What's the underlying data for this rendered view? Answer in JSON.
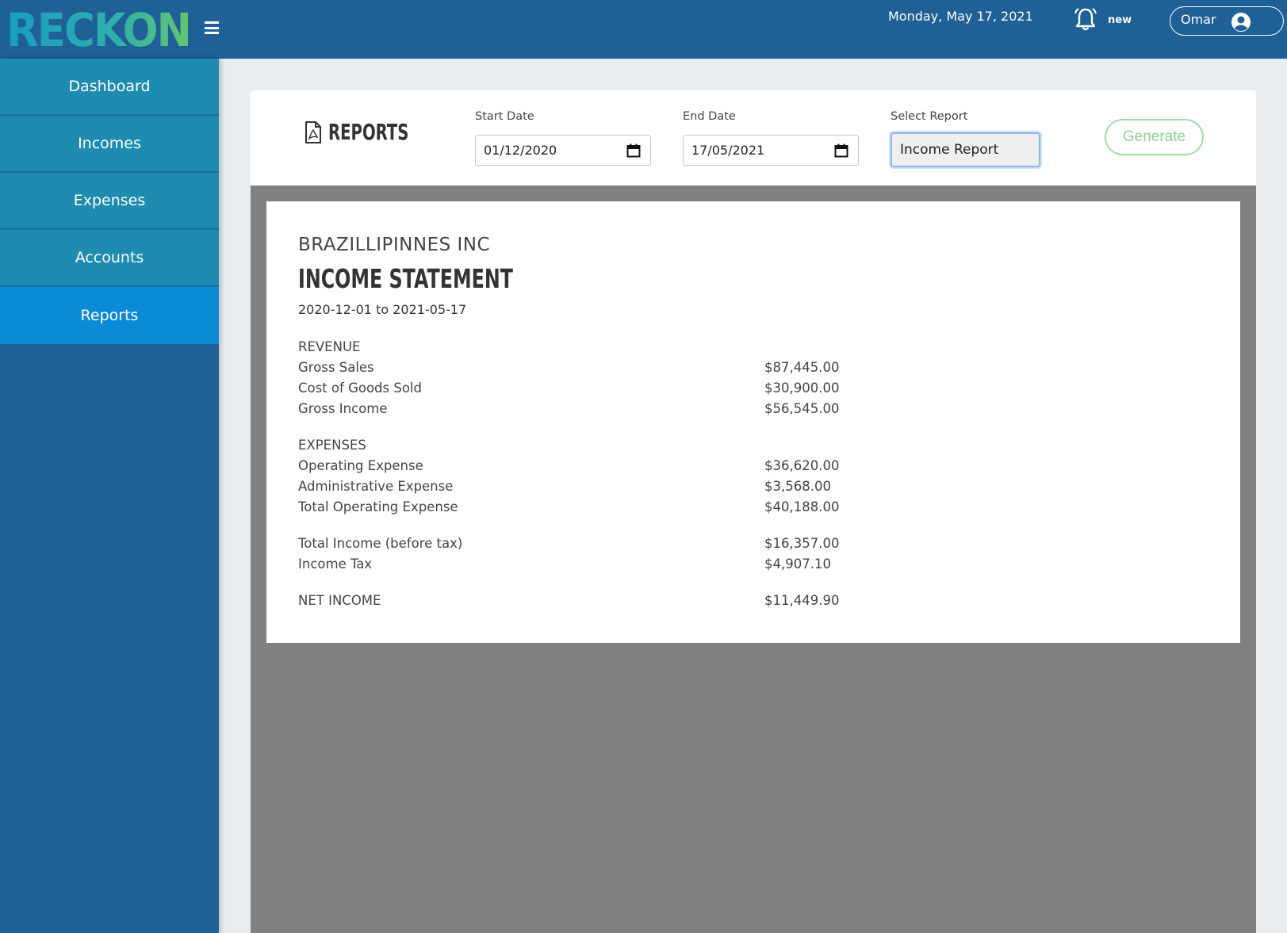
{
  "brand": {
    "logo_text": "RECKON",
    "colors": {
      "topbar": "#1f6096",
      "nav_item": "#1e8bb1",
      "nav_active": "#0b8bd6",
      "generate": "#8fd08f"
    }
  },
  "topbar": {
    "date": "Monday, May 17, 2021",
    "notification_badge": "new",
    "user_name": "Omar"
  },
  "sidebar": {
    "items": [
      {
        "label": "Dashboard",
        "active": false
      },
      {
        "label": "Incomes",
        "active": false
      },
      {
        "label": "Expenses",
        "active": false
      },
      {
        "label": "Accounts",
        "active": false
      },
      {
        "label": "Reports",
        "active": true
      }
    ]
  },
  "reports_panel": {
    "title": "REPORTS",
    "start_date": {
      "label": "Start Date",
      "value": "01/12/2020"
    },
    "end_date": {
      "label": "End Date",
      "value": "17/05/2021"
    },
    "select_report": {
      "label": "Select Report",
      "value": "Income Report"
    },
    "generate_label": "Generate"
  },
  "statement": {
    "company": "BRAZILLIPINNES INC",
    "title": "INCOME STATEMENT",
    "period": "2020-12-01 to 2021-05-17",
    "revenue": {
      "heading": "REVENUE",
      "rows": [
        {
          "label": "Gross Sales",
          "value": "$87,445.00"
        },
        {
          "label": "Cost of Goods Sold",
          "value": "$30,900.00"
        },
        {
          "label": "Gross Income",
          "value": "$56,545.00"
        }
      ]
    },
    "expenses": {
      "heading": "EXPENSES",
      "rows": [
        {
          "label": "Operating Expense",
          "value": "$36,620.00"
        },
        {
          "label": "Administrative Expense",
          "value": "$3,568.00"
        },
        {
          "label": "Total Operating Expense",
          "value": "$40,188.00"
        }
      ]
    },
    "totals": {
      "rows": [
        {
          "label": "Total Income (before tax)",
          "value": "$16,357.00"
        },
        {
          "label": "Income Tax",
          "value": "$4,907.10"
        }
      ]
    },
    "net": {
      "label": "NET INCOME",
      "value": "$11,449.90"
    }
  }
}
